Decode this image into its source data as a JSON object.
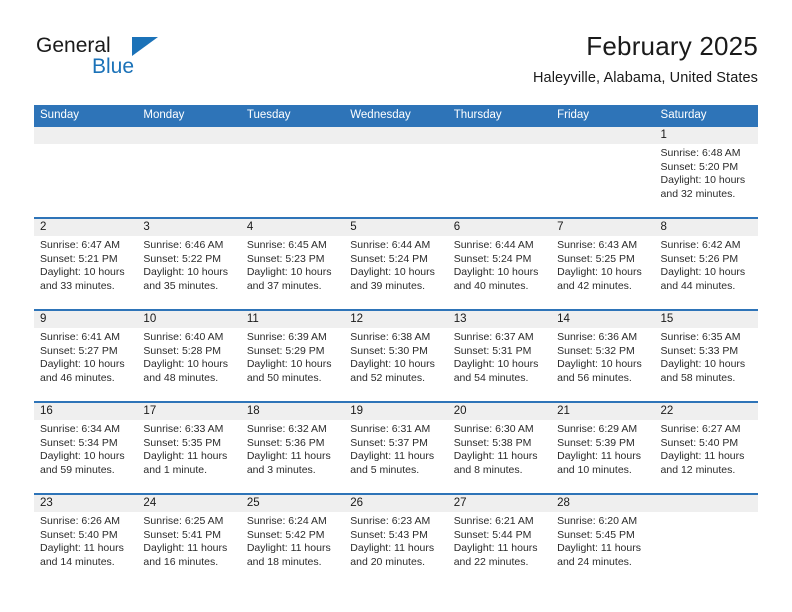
{
  "brand": {
    "name_top": "General",
    "name_bottom": "Blue",
    "triangle_color": "#1b72b8",
    "text_color": "#1a1a1a"
  },
  "header": {
    "title": "February 2025",
    "subtitle": "Haleyville, Alabama, United States"
  },
  "theme": {
    "header_blue": "#2e74b8",
    "daynum_gray": "#efefef",
    "text": "#1a1a1a"
  },
  "weekdays": [
    "Sunday",
    "Monday",
    "Tuesday",
    "Wednesday",
    "Thursday",
    "Friday",
    "Saturday"
  ],
  "weeks": [
    [
      {
        "day": "",
        "sunrise": "",
        "sunset": "",
        "daylight1": "",
        "daylight2": ""
      },
      {
        "day": "",
        "sunrise": "",
        "sunset": "",
        "daylight1": "",
        "daylight2": ""
      },
      {
        "day": "",
        "sunrise": "",
        "sunset": "",
        "daylight1": "",
        "daylight2": ""
      },
      {
        "day": "",
        "sunrise": "",
        "sunset": "",
        "daylight1": "",
        "daylight2": ""
      },
      {
        "day": "",
        "sunrise": "",
        "sunset": "",
        "daylight1": "",
        "daylight2": ""
      },
      {
        "day": "",
        "sunrise": "",
        "sunset": "",
        "daylight1": "",
        "daylight2": ""
      },
      {
        "day": "1",
        "sunrise": "Sunrise: 6:48 AM",
        "sunset": "Sunset: 5:20 PM",
        "daylight1": "Daylight: 10 hours",
        "daylight2": "and 32 minutes."
      }
    ],
    [
      {
        "day": "2",
        "sunrise": "Sunrise: 6:47 AM",
        "sunset": "Sunset: 5:21 PM",
        "daylight1": "Daylight: 10 hours",
        "daylight2": "and 33 minutes."
      },
      {
        "day": "3",
        "sunrise": "Sunrise: 6:46 AM",
        "sunset": "Sunset: 5:22 PM",
        "daylight1": "Daylight: 10 hours",
        "daylight2": "and 35 minutes."
      },
      {
        "day": "4",
        "sunrise": "Sunrise: 6:45 AM",
        "sunset": "Sunset: 5:23 PM",
        "daylight1": "Daylight: 10 hours",
        "daylight2": "and 37 minutes."
      },
      {
        "day": "5",
        "sunrise": "Sunrise: 6:44 AM",
        "sunset": "Sunset: 5:24 PM",
        "daylight1": "Daylight: 10 hours",
        "daylight2": "and 39 minutes."
      },
      {
        "day": "6",
        "sunrise": "Sunrise: 6:44 AM",
        "sunset": "Sunset: 5:24 PM",
        "daylight1": "Daylight: 10 hours",
        "daylight2": "and 40 minutes."
      },
      {
        "day": "7",
        "sunrise": "Sunrise: 6:43 AM",
        "sunset": "Sunset: 5:25 PM",
        "daylight1": "Daylight: 10 hours",
        "daylight2": "and 42 minutes."
      },
      {
        "day": "8",
        "sunrise": "Sunrise: 6:42 AM",
        "sunset": "Sunset: 5:26 PM",
        "daylight1": "Daylight: 10 hours",
        "daylight2": "and 44 minutes."
      }
    ],
    [
      {
        "day": "9",
        "sunrise": "Sunrise: 6:41 AM",
        "sunset": "Sunset: 5:27 PM",
        "daylight1": "Daylight: 10 hours",
        "daylight2": "and 46 minutes."
      },
      {
        "day": "10",
        "sunrise": "Sunrise: 6:40 AM",
        "sunset": "Sunset: 5:28 PM",
        "daylight1": "Daylight: 10 hours",
        "daylight2": "and 48 minutes."
      },
      {
        "day": "11",
        "sunrise": "Sunrise: 6:39 AM",
        "sunset": "Sunset: 5:29 PM",
        "daylight1": "Daylight: 10 hours",
        "daylight2": "and 50 minutes."
      },
      {
        "day": "12",
        "sunrise": "Sunrise: 6:38 AM",
        "sunset": "Sunset: 5:30 PM",
        "daylight1": "Daylight: 10 hours",
        "daylight2": "and 52 minutes."
      },
      {
        "day": "13",
        "sunrise": "Sunrise: 6:37 AM",
        "sunset": "Sunset: 5:31 PM",
        "daylight1": "Daylight: 10 hours",
        "daylight2": "and 54 minutes."
      },
      {
        "day": "14",
        "sunrise": "Sunrise: 6:36 AM",
        "sunset": "Sunset: 5:32 PM",
        "daylight1": "Daylight: 10 hours",
        "daylight2": "and 56 minutes."
      },
      {
        "day": "15",
        "sunrise": "Sunrise: 6:35 AM",
        "sunset": "Sunset: 5:33 PM",
        "daylight1": "Daylight: 10 hours",
        "daylight2": "and 58 minutes."
      }
    ],
    [
      {
        "day": "16",
        "sunrise": "Sunrise: 6:34 AM",
        "sunset": "Sunset: 5:34 PM",
        "daylight1": "Daylight: 10 hours",
        "daylight2": "and 59 minutes."
      },
      {
        "day": "17",
        "sunrise": "Sunrise: 6:33 AM",
        "sunset": "Sunset: 5:35 PM",
        "daylight1": "Daylight: 11 hours",
        "daylight2": "and 1 minute."
      },
      {
        "day": "18",
        "sunrise": "Sunrise: 6:32 AM",
        "sunset": "Sunset: 5:36 PM",
        "daylight1": "Daylight: 11 hours",
        "daylight2": "and 3 minutes."
      },
      {
        "day": "19",
        "sunrise": "Sunrise: 6:31 AM",
        "sunset": "Sunset: 5:37 PM",
        "daylight1": "Daylight: 11 hours",
        "daylight2": "and 5 minutes."
      },
      {
        "day": "20",
        "sunrise": "Sunrise: 6:30 AM",
        "sunset": "Sunset: 5:38 PM",
        "daylight1": "Daylight: 11 hours",
        "daylight2": "and 8 minutes."
      },
      {
        "day": "21",
        "sunrise": "Sunrise: 6:29 AM",
        "sunset": "Sunset: 5:39 PM",
        "daylight1": "Daylight: 11 hours",
        "daylight2": "and 10 minutes."
      },
      {
        "day": "22",
        "sunrise": "Sunrise: 6:27 AM",
        "sunset": "Sunset: 5:40 PM",
        "daylight1": "Daylight: 11 hours",
        "daylight2": "and 12 minutes."
      }
    ],
    [
      {
        "day": "23",
        "sunrise": "Sunrise: 6:26 AM",
        "sunset": "Sunset: 5:40 PM",
        "daylight1": "Daylight: 11 hours",
        "daylight2": "and 14 minutes."
      },
      {
        "day": "24",
        "sunrise": "Sunrise: 6:25 AM",
        "sunset": "Sunset: 5:41 PM",
        "daylight1": "Daylight: 11 hours",
        "daylight2": "and 16 minutes."
      },
      {
        "day": "25",
        "sunrise": "Sunrise: 6:24 AM",
        "sunset": "Sunset: 5:42 PM",
        "daylight1": "Daylight: 11 hours",
        "daylight2": "and 18 minutes."
      },
      {
        "day": "26",
        "sunrise": "Sunrise: 6:23 AM",
        "sunset": "Sunset: 5:43 PM",
        "daylight1": "Daylight: 11 hours",
        "daylight2": "and 20 minutes."
      },
      {
        "day": "27",
        "sunrise": "Sunrise: 6:21 AM",
        "sunset": "Sunset: 5:44 PM",
        "daylight1": "Daylight: 11 hours",
        "daylight2": "and 22 minutes."
      },
      {
        "day": "28",
        "sunrise": "Sunrise: 6:20 AM",
        "sunset": "Sunset: 5:45 PM",
        "daylight1": "Daylight: 11 hours",
        "daylight2": "and 24 minutes."
      },
      {
        "day": "",
        "sunrise": "",
        "sunset": "",
        "daylight1": "",
        "daylight2": ""
      }
    ]
  ]
}
